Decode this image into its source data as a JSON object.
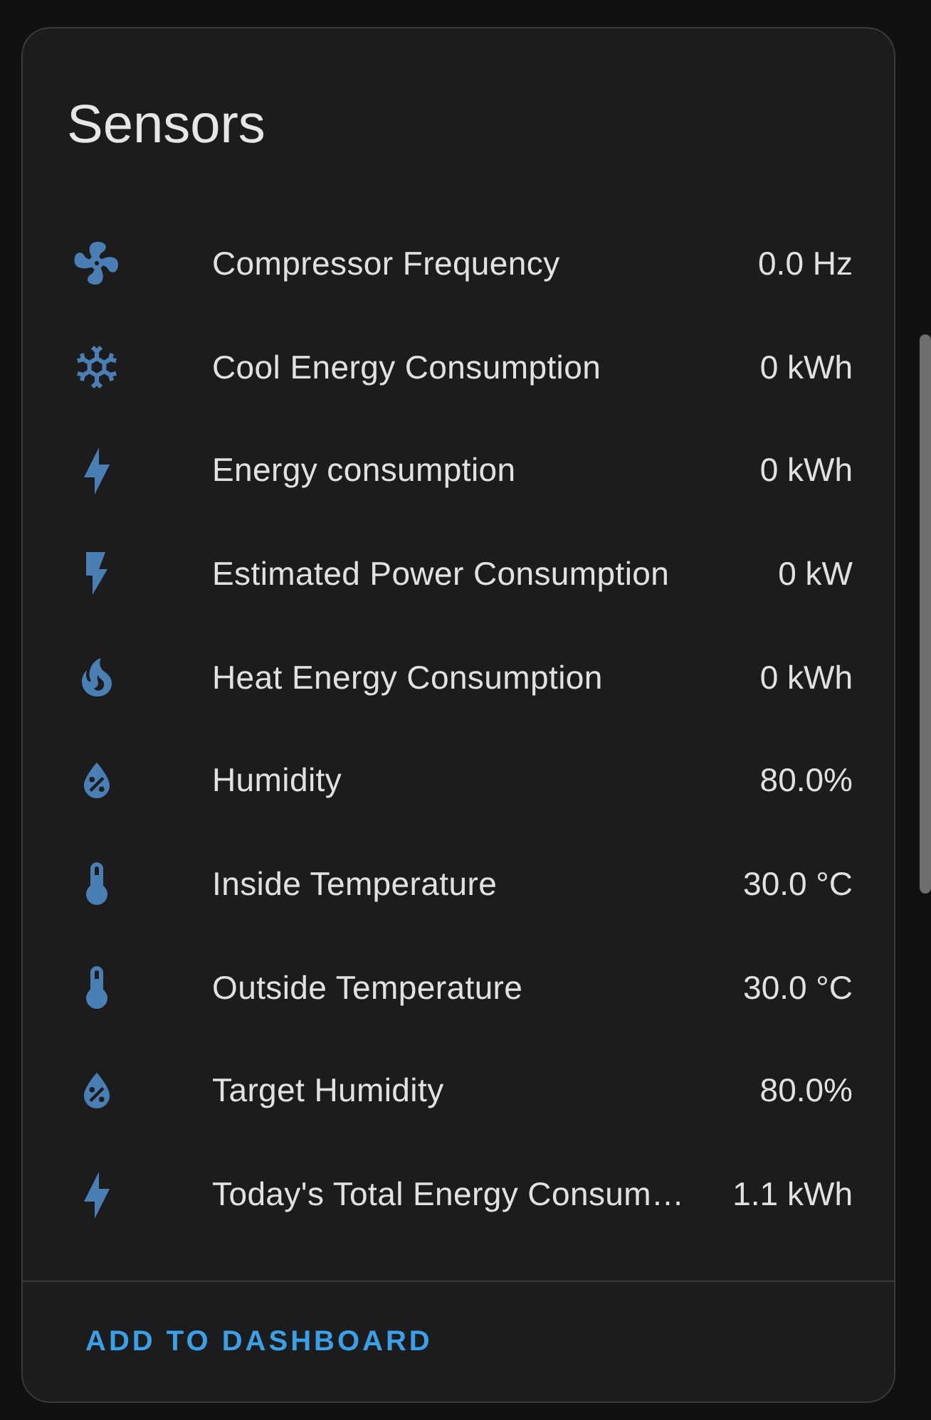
{
  "card": {
    "title": "Sensors",
    "rows": [
      {
        "kind": "fan",
        "name": "Compressor Frequency",
        "value": "0.0 Hz"
      },
      {
        "kind": "snowflake",
        "name": "Cool Energy Consumption",
        "value": "0 kWh"
      },
      {
        "kind": "bolt",
        "name": "Energy consumption",
        "value": "0 kWh"
      },
      {
        "kind": "boltbox",
        "name": "Estimated Power Consumption",
        "value": "0 kW"
      },
      {
        "kind": "fire",
        "name": "Heat Energy Consumption",
        "value": "0 kWh"
      },
      {
        "kind": "drop",
        "name": "Humidity",
        "value": "80.0%"
      },
      {
        "kind": "thermometer",
        "name": "Inside Temperature",
        "value": "30.0 °C"
      },
      {
        "kind": "thermometer",
        "name": "Outside Temperature",
        "value": "30.0 °C"
      },
      {
        "kind": "drop",
        "name": "Target Humidity",
        "value": "80.0%"
      },
      {
        "kind": "bolt",
        "name": "Today's Total Energy Consum…",
        "value": "1.1 kWh"
      }
    ],
    "action": "ADD TO DASHBOARD"
  }
}
